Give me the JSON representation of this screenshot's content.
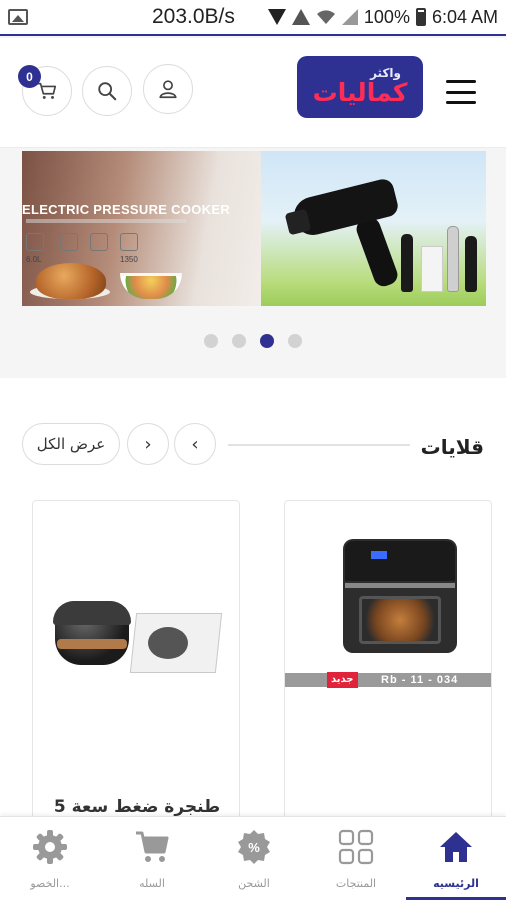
{
  "status_bar": {
    "speed": "203.0B/s",
    "battery": "100%",
    "time": "6:04 AM"
  },
  "header": {
    "cart_count": "0",
    "logo_small": "واكثر",
    "logo_main": "كماليات",
    "icons": [
      "cart-icon",
      "search-icon",
      "user-icon",
      "menu-icon"
    ]
  },
  "banner": {
    "slide1_title": "ELECTRIC PRESSURE COOKER",
    "slide1_specs": [
      "6.0L",
      "1350"
    ],
    "dots_count": 4,
    "active_dot": 3
  },
  "section": {
    "title": "قلايات",
    "view_all": "عرض الكل",
    "prev_arrow": "‹",
    "next_arrow": "›"
  },
  "products": [
    {
      "badge": "جديد",
      "code": "Rb - 11 - 034"
    },
    {
      "name": "طنجرة ضغط سعة 5"
    }
  ],
  "bottom_nav": {
    "items": [
      {
        "label": "الرئيسيه",
        "icon": "home-icon",
        "active": true
      },
      {
        "label": "المنتجات",
        "icon": "grid-icon",
        "active": false
      },
      {
        "label": "الشحن",
        "icon": "percent-icon",
        "active": false
      },
      {
        "label": "السله",
        "icon": "cart-icon",
        "active": false
      },
      {
        "label": "الخصو...",
        "icon": "gear-icon",
        "active": false
      }
    ]
  },
  "colors": {
    "brand": "#2e3192",
    "accent": "#ff2d55",
    "badge_red": "#e0233a"
  }
}
